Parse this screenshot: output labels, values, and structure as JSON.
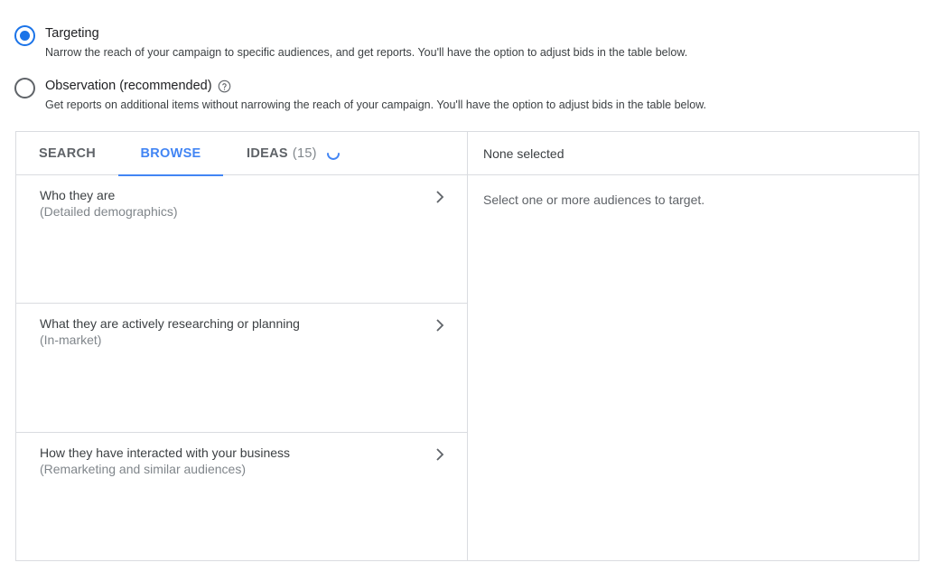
{
  "bid_options": {
    "targeting": {
      "label": "Targeting",
      "description": "Narrow the reach of your campaign to specific audiences, and get reports. You'll have the option to adjust bids in the table below.",
      "selected": true
    },
    "observation": {
      "label": "Observation (recommended)",
      "description": "Get reports on additional items without narrowing the reach of your campaign. You'll have the option to adjust bids in the table below.",
      "selected": false,
      "help_icon": "help-circle-icon"
    }
  },
  "tabs": {
    "search": "SEARCH",
    "browse": "BROWSE",
    "ideas": "IDEAS",
    "ideas_count": "(15)",
    "active": "browse"
  },
  "browse_categories": [
    {
      "title": "Who they are",
      "subtitle": "(Detailed demographics)"
    },
    {
      "title": "What they are actively researching or planning",
      "subtitle": "(In-market)"
    },
    {
      "title": "How they have interacted with your business",
      "subtitle": "(Remarketing and similar audiences)"
    }
  ],
  "selection": {
    "header": "None selected",
    "empty_message": "Select one or more audiences to target."
  },
  "colors": {
    "accent": "#4285f4",
    "radio_selected": "#1a73e8",
    "border": "#dadce0"
  }
}
